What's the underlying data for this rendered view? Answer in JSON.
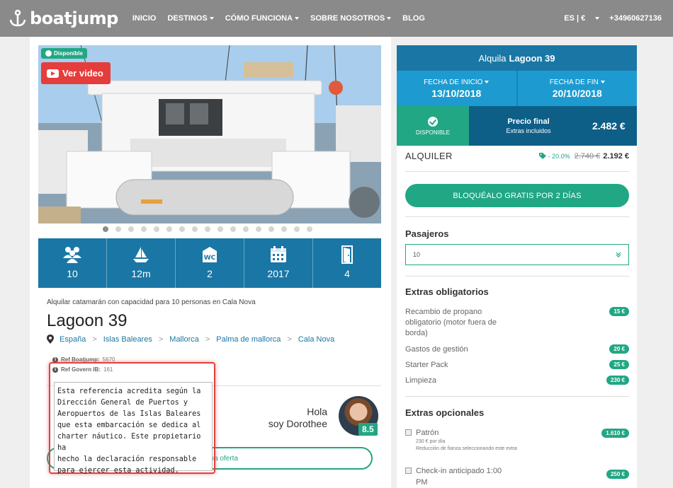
{
  "nav": {
    "logo": "boatjump",
    "menu": [
      "INICIO",
      "DESTINOS",
      "CÓMO FUNCIONA",
      "SOBRE NOSOTROS",
      "BLOG"
    ],
    "locale": "ES | €",
    "phone": "+34960627136"
  },
  "listing": {
    "badge": "Disponible",
    "video": "Ver video",
    "specs": [
      {
        "icon": "passengers-icon",
        "value": "10"
      },
      {
        "icon": "boat-length-icon",
        "value": "12m"
      },
      {
        "icon": "wc-icon",
        "value": "2"
      },
      {
        "icon": "calendar-year-icon",
        "value": "2017"
      },
      {
        "icon": "cabin-door-icon",
        "value": "4"
      }
    ],
    "subtitle": "Alquilar catamarán con capacidad para 10 personas en Cala Nova",
    "title": "Lagoon 39",
    "breadcrumbs": [
      "España",
      "Islas Baleares",
      "Mallorca",
      "Palma de mallorca",
      "Cala Nova"
    ],
    "ref_boatjump_label": "Ref Boatjump:",
    "ref_boatjump": "5670",
    "ref_govern_label": "Ref Govern IB:",
    "ref_govern": "161",
    "tooltip_lines": [
      "Esta referencia acredita según la",
      "Dirección General de Puertos y",
      "Aeropuertos de las Islas Baleares",
      "que esta embarcación se dedica al",
      "charter náutico. Este propietario ha",
      "hecho la declaración responsable",
      "para ejercer esta actividad."
    ],
    "greeting_1": "Hola",
    "greeting_2": "soy Dorothee",
    "rating": "8.5",
    "offer_btn": "Solicita una oferta"
  },
  "panel": {
    "head_prefix": "Alquila",
    "head_boat": "Lagoon 39",
    "start_label": "FECHA DE INICIO",
    "start_date": "13/10/2018",
    "end_label": "FECHA DE FIN",
    "end_date": "20/10/2018",
    "status": "DISPONIBLE",
    "price_label": "Precio final",
    "price_sub": "Extras incluidos",
    "price": "2.482 €",
    "rent_label": "ALQUILER",
    "discount": "- 20.0%",
    "old_price": "2.740 €",
    "new_price": "2.192 €",
    "block_btn": "BLOQUÉALO GRATIS POR 2 DÍAS",
    "passengers_title": "Pasajeros",
    "passengers_value": "10",
    "mandatory_title": "Extras obligatorios",
    "mandatory": [
      {
        "name": "Recambio de propano obligatorio (motor fuera de borda)",
        "price": "15 €"
      },
      {
        "name": "Gastos de gestión",
        "price": "20 €"
      },
      {
        "name": "Starter Pack",
        "price": "25 €"
      },
      {
        "name": "Limpieza",
        "price": "230 €"
      }
    ],
    "optional_title": "Extras opcionales",
    "optional": [
      {
        "name": "Patrón",
        "sub1": "230 € por día",
        "sub2": "Reducción de fianza seleccionando este extra",
        "price": "1.610 €"
      },
      {
        "name": "Check-in anticipado 1:00 PM",
        "price": "250 €"
      }
    ]
  }
}
